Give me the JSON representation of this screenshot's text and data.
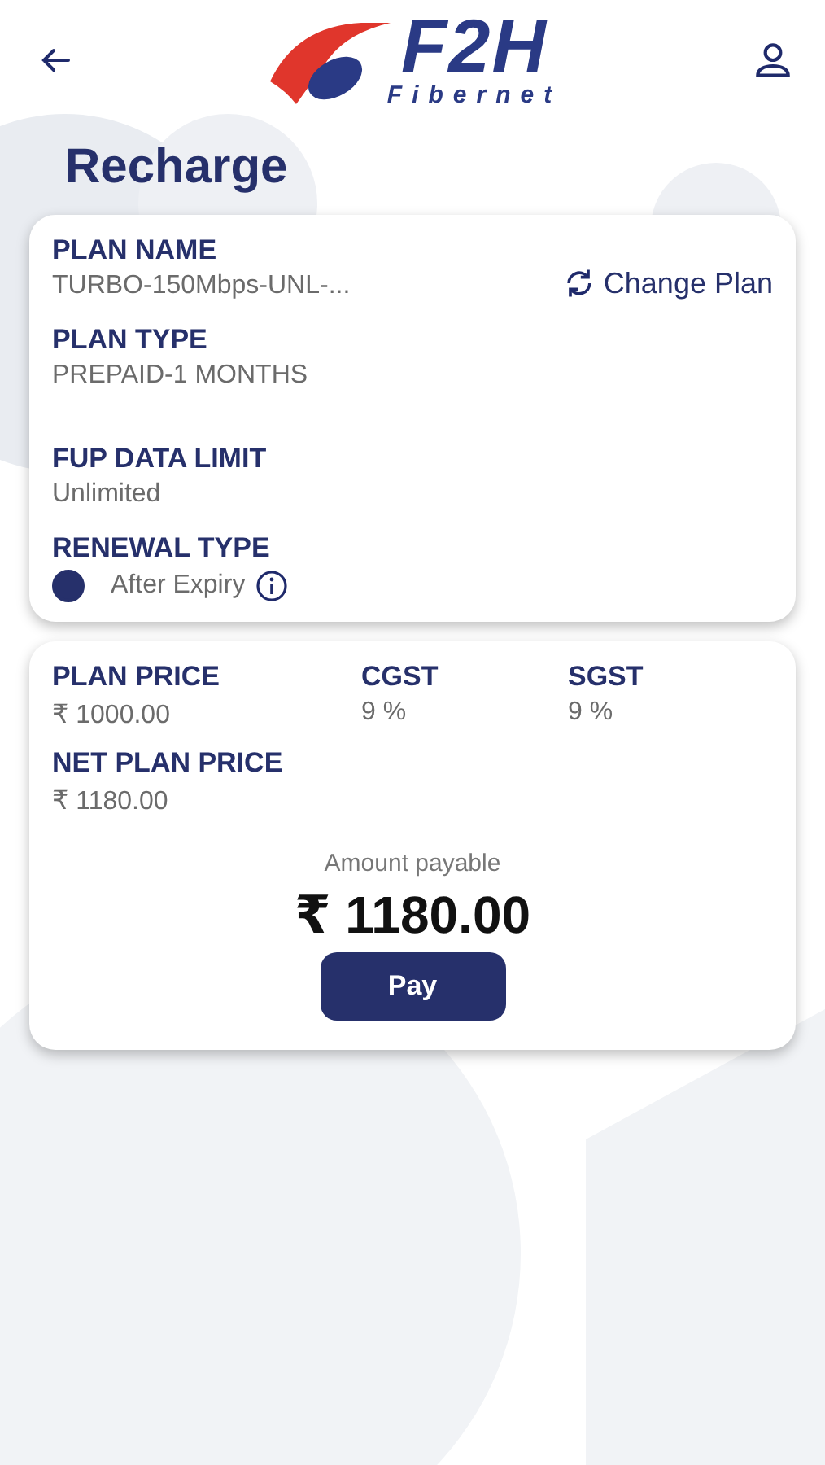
{
  "header": {
    "logo": {
      "wordmark": "F2H",
      "tagline": "Fibernet"
    }
  },
  "title": "Recharge",
  "plan_card": {
    "plan_name": {
      "label": "PLAN NAME",
      "value": "TURBO-150Mbps-UNL-..."
    },
    "change_plan": "Change Plan",
    "plan_type": {
      "label": "PLAN TYPE",
      "value": "PREPAID-1 MONTHS"
    },
    "fup": {
      "label": "FUP DATA LIMIT",
      "value": "Unlimited"
    },
    "renewal": {
      "label": "RENEWAL TYPE",
      "options": [
        {
          "label": "After Expiry",
          "selected": true
        }
      ]
    }
  },
  "price_card": {
    "columns": [
      {
        "label": "PLAN PRICE",
        "value": "₹ 1000.00"
      },
      {
        "label": "CGST",
        "value": "9 %"
      },
      {
        "label": "SGST",
        "value": "9 %"
      }
    ],
    "net": {
      "label": "NET PLAN PRICE",
      "value": "₹ 1180.00"
    },
    "amount_label": "Amount payable",
    "amount": "₹ 1180.00",
    "pay_button": "Pay"
  }
}
